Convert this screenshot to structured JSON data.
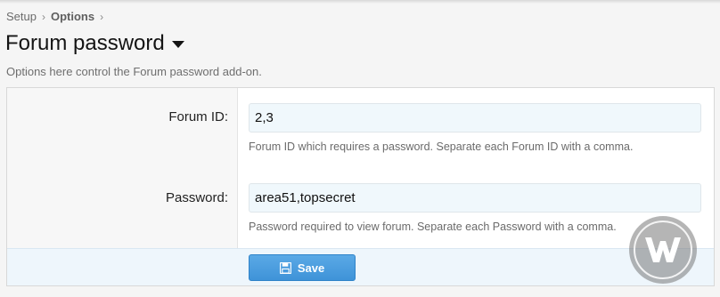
{
  "breadcrumb": {
    "items": [
      {
        "label": "Setup"
      },
      {
        "label": "Options"
      }
    ]
  },
  "page": {
    "title": "Forum password",
    "description": "Options here control the Forum password add-on."
  },
  "form": {
    "fields": [
      {
        "label": "Forum ID:",
        "value": "2,3",
        "hint": "Forum ID which requires a password. Separate each Forum ID with a comma."
      },
      {
        "label": "Password:",
        "value": "area51,topsecret",
        "hint": "Password required to view forum. Separate each Password with a comma."
      }
    ],
    "save_label": "Save"
  },
  "icons": {
    "title_toggle": "caret-down-icon",
    "save": "floppy-disk-icon",
    "watermark": "w-logo-icon"
  },
  "colors": {
    "accent": "#4a9fe0",
    "input_bg": "#f0f8fc",
    "footer_bg": "#eef6fc"
  }
}
